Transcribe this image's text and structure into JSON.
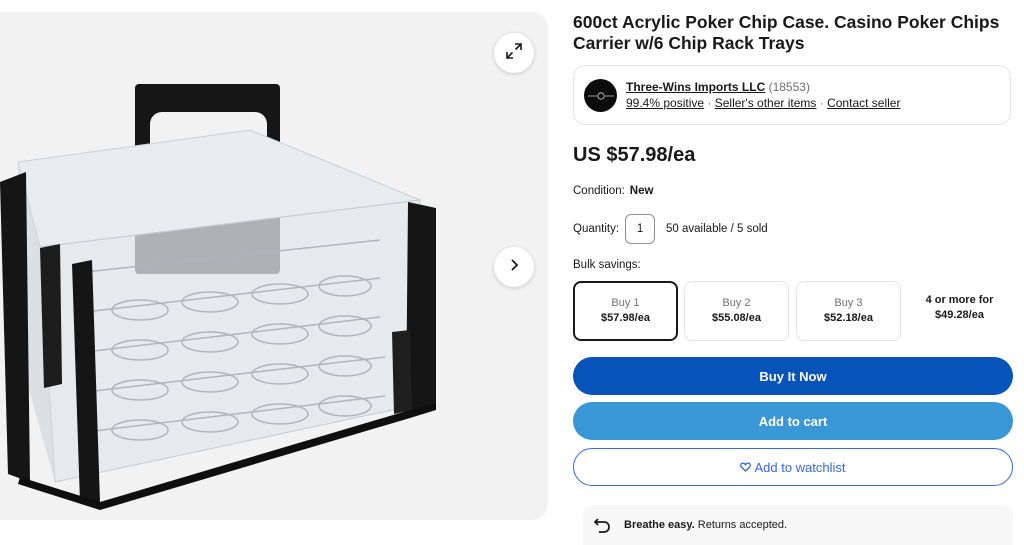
{
  "product": {
    "title": "600ct Acrylic Poker Chip Case. Casino Poker Chips Carrier w/6 Chip Rack Trays",
    "price": "US $57.98/ea"
  },
  "seller": {
    "name": "Three-Wins Imports LLC",
    "feedback_count": "(18553)",
    "positive": "99.4% positive",
    "separator": "·",
    "other_items": "Seller's other items",
    "contact": "Contact seller"
  },
  "condition": {
    "label": "Condition:",
    "value": "New"
  },
  "quantity": {
    "label": "Quantity:",
    "value": "1",
    "availability": "50 available / 5 sold"
  },
  "bulk": {
    "label": "Bulk savings:",
    "tiers": [
      {
        "qty": "Buy 1",
        "price": "$57.98/ea",
        "selected": true
      },
      {
        "qty": "Buy 2",
        "price": "$55.08/ea",
        "selected": false
      },
      {
        "qty": "Buy 3",
        "price": "$52.18/ea",
        "selected": false
      },
      {
        "qty": "4 or more for",
        "price": "$49.28/ea",
        "selected": false
      }
    ]
  },
  "actions": {
    "buy_now": "Buy It Now",
    "add_to_cart": "Add to cart",
    "watchlist": "Add to watchlist",
    "watchlist_icon": "heart-outline-icon"
  },
  "returns": {
    "bold": "Breathe easy.",
    "text": " Returns accepted."
  },
  "colors": {
    "primary_blue": "#0654ba",
    "cart_blue": "#3a97d6",
    "link_blue": "#3665f3",
    "text": "#191919",
    "muted": "#707070"
  },
  "icons": {
    "expand": "expand-icon",
    "next": "chevron-right-icon",
    "returns": "return-arrow-icon"
  }
}
